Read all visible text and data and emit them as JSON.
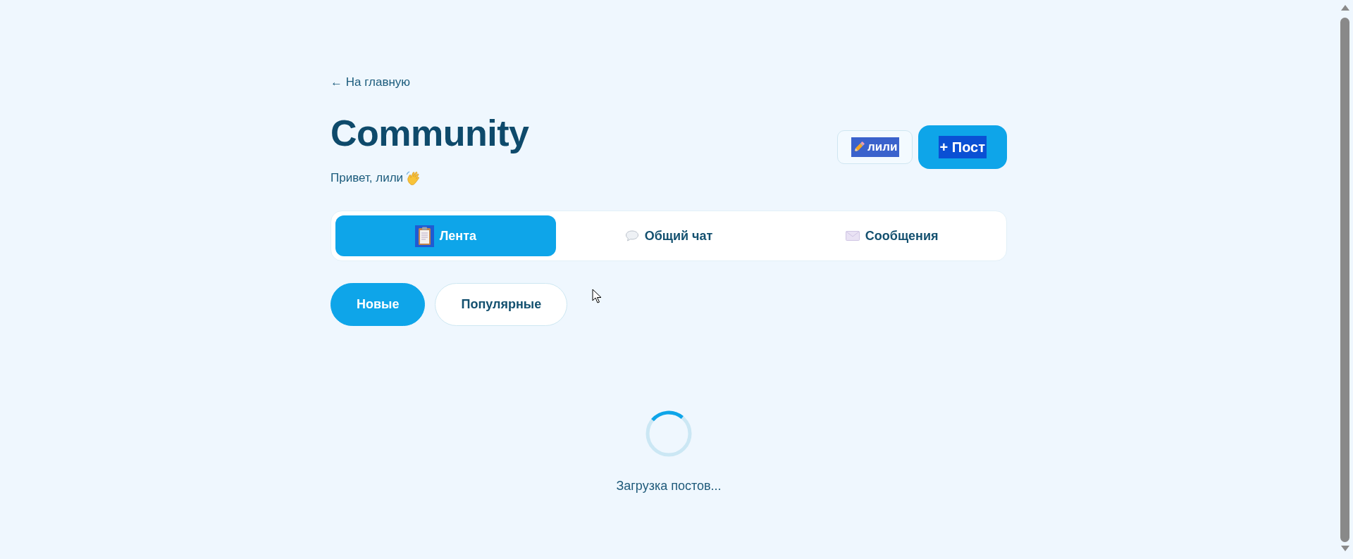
{
  "back_link": {
    "label": "← На главную"
  },
  "header": {
    "title": "Community",
    "greeting": "Привет, лили"
  },
  "actions": [
    {
      "kind": "profile",
      "label": "лили",
      "highlighted": true
    },
    {
      "kind": "new_post",
      "label": "+ Пост",
      "highlighted": true
    }
  ],
  "tabs": [
    {
      "kind": "feed",
      "label": "Лента",
      "selected": true,
      "icon_highlighted": true
    },
    {
      "kind": "chat",
      "label": "Общий чат",
      "selected": false,
      "icon_highlighted": false
    },
    {
      "kind": "messages",
      "label": "Сообщения",
      "selected": false,
      "icon_highlighted": false
    }
  ],
  "filters": [
    {
      "label": "Новые",
      "selected": true
    },
    {
      "label": "Популярные",
      "selected": false
    }
  ],
  "loading": {
    "text": "Загрузка постов..."
  }
}
